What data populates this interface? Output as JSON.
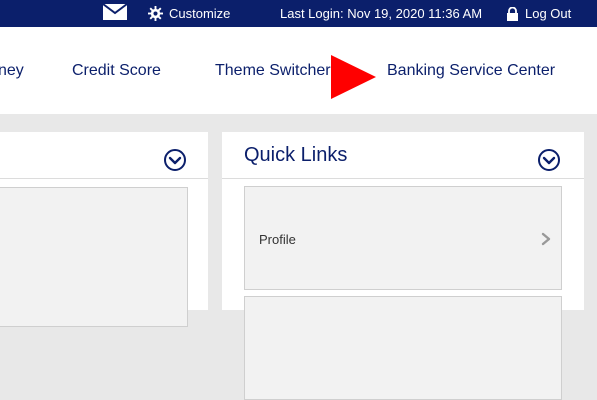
{
  "topbar": {
    "mail_icon": "envelope-icon",
    "customize_icon": "gear-icon",
    "customize_label": "Customize",
    "last_login": "Last Login: Nov 19, 2020 11:36 AM",
    "logout_icon": "lock-icon",
    "logout_label": "Log Out"
  },
  "nav": {
    "items": [
      {
        "label": "ney"
      },
      {
        "label": "Credit Score"
      },
      {
        "label": "Theme Switcher"
      },
      {
        "label": "Banking Service Center"
      }
    ],
    "annotation_arrow_color": "#ff0000"
  },
  "quick_links": {
    "title": "Quick Links",
    "toggle_icon": "chevron-down-circle-icon",
    "items": [
      {
        "label": "Profile",
        "icon": "chevron-right-icon"
      },
      {
        "label": ""
      }
    ]
  },
  "left_panel": {
    "toggle_icon": "chevron-down-circle-icon"
  },
  "colors": {
    "brand_navy": "#0b1f6b",
    "background_gray": "#e8e8e8",
    "card_gray": "#f2f2f2"
  }
}
